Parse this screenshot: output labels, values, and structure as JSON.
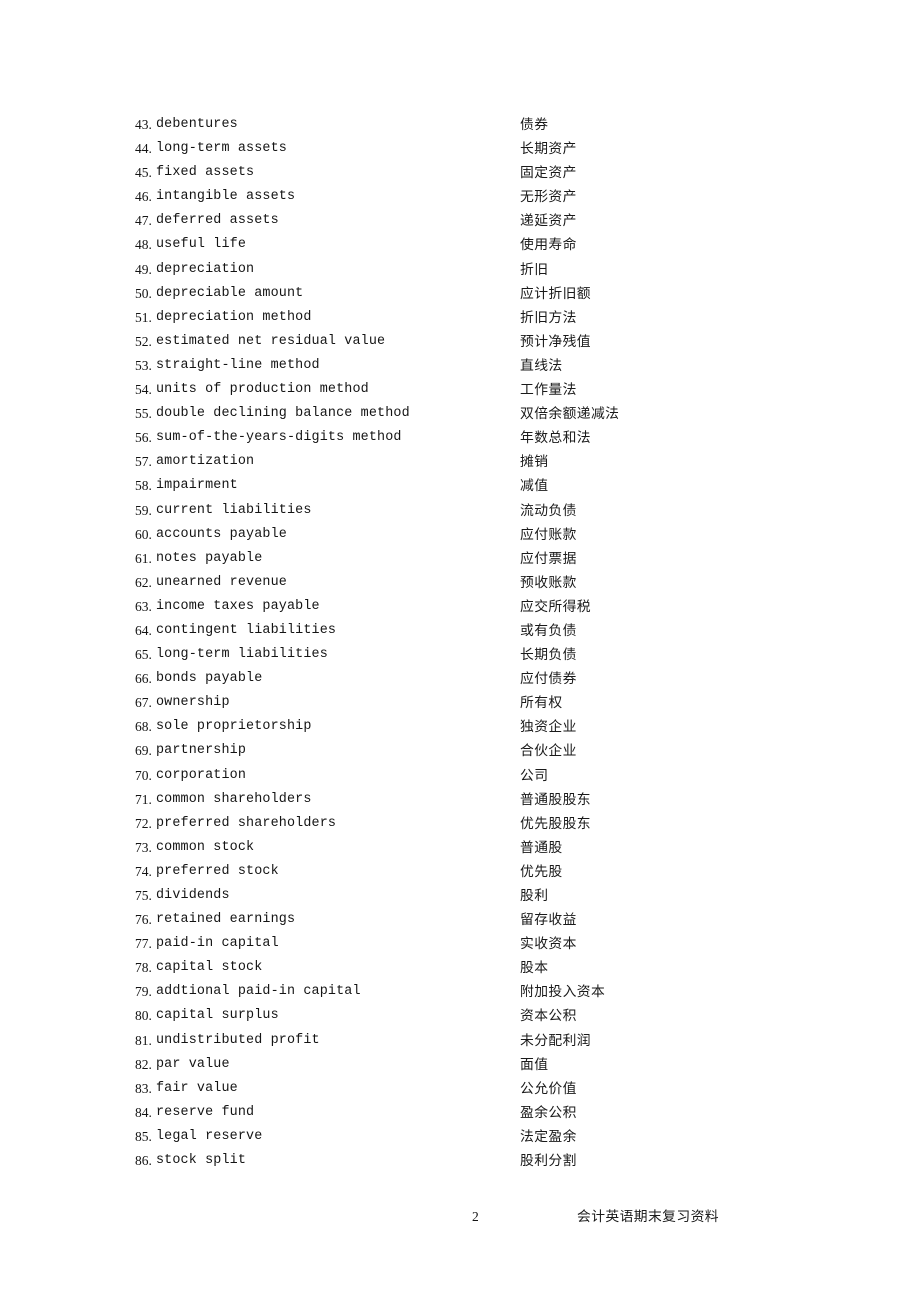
{
  "document": {
    "footer": {
      "page_number": "2",
      "doc_title": "会计英语期末复习资料"
    }
  },
  "vocabulary": {
    "entries": [
      {
        "index": "43.",
        "en": "debentures",
        "zh": "债券"
      },
      {
        "index": "44.",
        "en": "long-term assets",
        "zh": "长期资产"
      },
      {
        "index": "45.",
        "en": "fixed assets",
        "zh": "固定资产"
      },
      {
        "index": "46.",
        "en": "intangible assets",
        "zh": "无形资产"
      },
      {
        "index": "47.",
        "en": "deferred assets",
        "zh": "递延资产"
      },
      {
        "index": "48.",
        "en": "useful life",
        "zh": "使用寿命"
      },
      {
        "index": "49.",
        "en": "depreciation",
        "zh": "折旧"
      },
      {
        "index": "50.",
        "en": "depreciable amount",
        "zh": "应计折旧额"
      },
      {
        "index": "51.",
        "en": "depreciation method",
        "zh": "折旧方法"
      },
      {
        "index": "52.",
        "en": "estimated net residual value",
        "zh": "预计净残值"
      },
      {
        "index": "53.",
        "en": "straight-line method",
        "zh": "直线法"
      },
      {
        "index": "54.",
        "en": "units of production method",
        "zh": "工作量法"
      },
      {
        "index": "55.",
        "en": "double declining balance method",
        "zh": "双倍余额递减法"
      },
      {
        "index": "56.",
        "en": "sum-of-the-years-digits method",
        "zh": "年数总和法"
      },
      {
        "index": "57.",
        "en": "amortization",
        "zh": "摊销"
      },
      {
        "index": "58.",
        "en": "impairment",
        "zh": "减值"
      },
      {
        "index": "59.",
        "en": "current liabilities",
        "zh": "流动负债"
      },
      {
        "index": "60.",
        "en": "accounts payable",
        "zh": "应付账款"
      },
      {
        "index": "61.",
        "en": "notes payable",
        "zh": "应付票据"
      },
      {
        "index": "62.",
        "en": "unearned revenue",
        "zh": "预收账款"
      },
      {
        "index": "63.",
        "en": "income taxes payable",
        "zh": "应交所得税"
      },
      {
        "index": "64.",
        "en": "contingent liabilities",
        "zh": "或有负债"
      },
      {
        "index": "65.",
        "en": "long-term liabilities",
        "zh": "长期负债"
      },
      {
        "index": "66.",
        "en": "bonds payable",
        "zh": "应付债券"
      },
      {
        "index": "67.",
        "en": "ownership",
        "zh": "所有权"
      },
      {
        "index": "68.",
        "en": "sole proprietorship",
        "zh": "独资企业"
      },
      {
        "index": "69.",
        "en": "partnership",
        "zh": "合伙企业"
      },
      {
        "index": "70.",
        "en": "corporation",
        "zh": "公司"
      },
      {
        "index": "71.",
        "en": "common shareholders",
        "zh": "普通股股东"
      },
      {
        "index": "72.",
        "en": "preferred shareholders",
        "zh": "优先股股东"
      },
      {
        "index": "73.",
        "en": "common stock",
        "zh": "普通股"
      },
      {
        "index": "74.",
        "en": "preferred stock",
        "zh": "优先股"
      },
      {
        "index": "75.",
        "en": "dividends",
        "zh": "股利"
      },
      {
        "index": "76.",
        "en": "retained earnings",
        "zh": "留存收益"
      },
      {
        "index": "77.",
        "en": "paid-in capital",
        "zh": "实收资本"
      },
      {
        "index": "78.",
        "en": "capital stock",
        "zh": "股本"
      },
      {
        "index": "79.",
        "en": "addtional paid-in capital",
        "zh": "附加投入资本"
      },
      {
        "index": "80.",
        "en": "capital surplus",
        "zh": "资本公积"
      },
      {
        "index": "81.",
        "en": "undistributed profit",
        "zh": "未分配利润"
      },
      {
        "index": "82.",
        "en": "par value",
        "zh": "面值"
      },
      {
        "index": "83.",
        "en": "fair value",
        "zh": "公允价值"
      },
      {
        "index": "84.",
        "en": "reserve fund",
        "zh": "盈余公积"
      },
      {
        "index": "85.",
        "en": "legal reserve",
        "zh": "法定盈余"
      },
      {
        "index": "86.",
        "en": "stock split",
        "zh": "股利分割"
      }
    ]
  }
}
